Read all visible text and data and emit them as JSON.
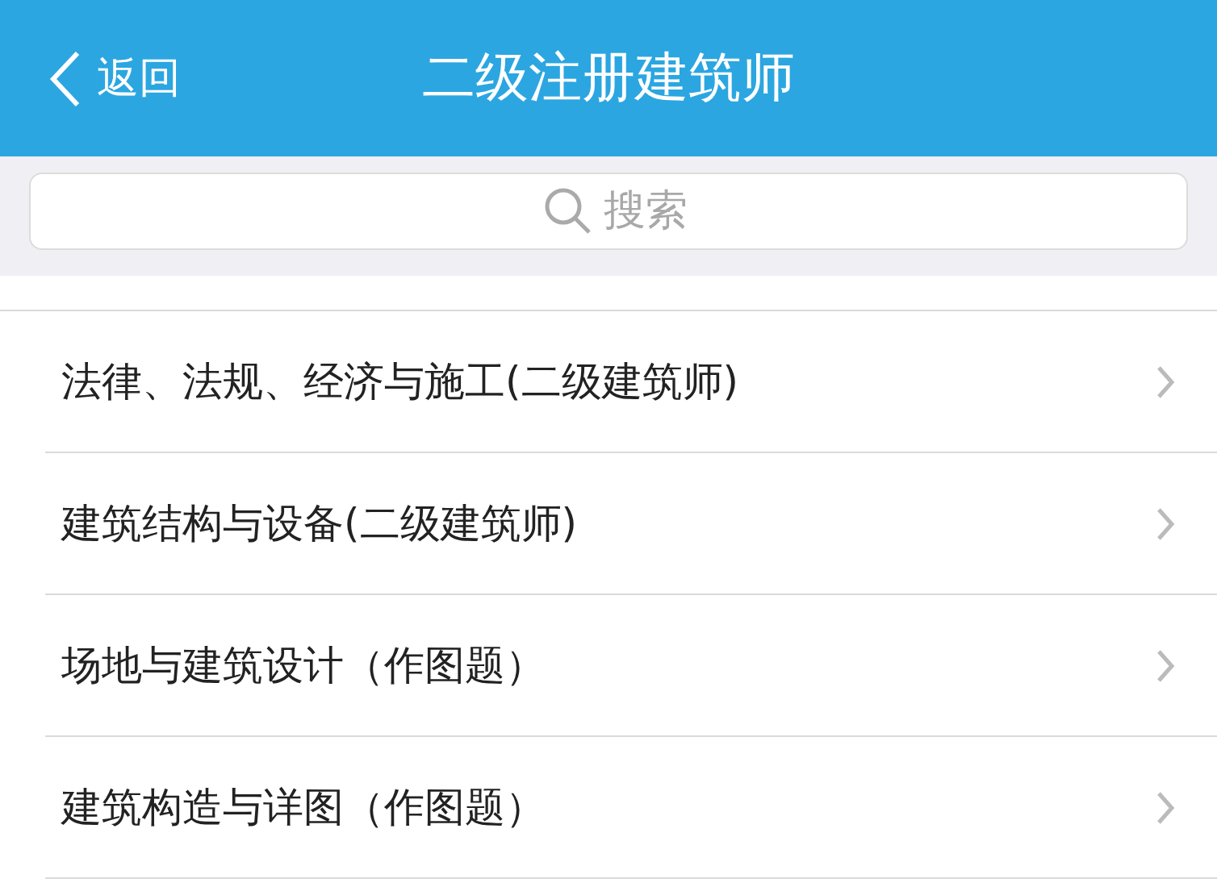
{
  "header": {
    "back_label": "返回",
    "title": "二级注册建筑师"
  },
  "search": {
    "placeholder": "搜索"
  },
  "items": [
    {
      "label": "法律、法规、经济与施工(二级建筑师)"
    },
    {
      "label": "建筑结构与设备(二级建筑师)"
    },
    {
      "label": "场地与建筑设计（作图题）"
    },
    {
      "label": "建筑构造与详图（作图题）"
    }
  ]
}
